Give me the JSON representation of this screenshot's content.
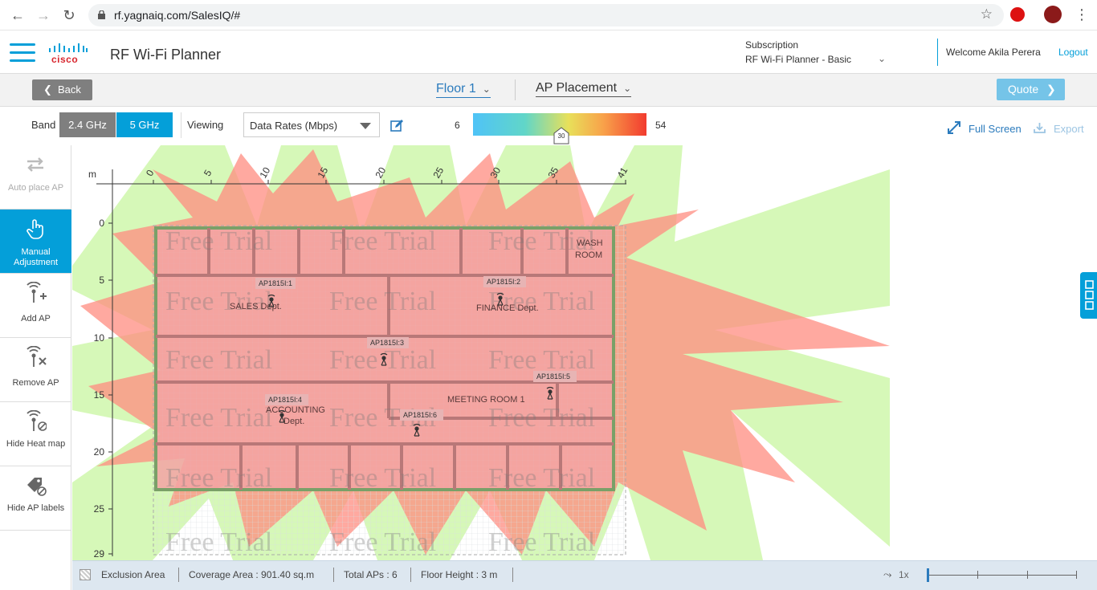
{
  "browser": {
    "url": "rf.yagnaiq.com/SalesIQ/#"
  },
  "header": {
    "brand": "cisco",
    "app_title": "RF Wi-Fi Planner",
    "subscription_label": "Subscription",
    "subscription_value": "RF Wi-Fi Planner - Basic",
    "welcome": "Welcome Akila Perera",
    "logout": "Logout"
  },
  "subheader": {
    "back": "Back",
    "floor": "Floor 1",
    "mode": "AP Placement",
    "quote": "Quote"
  },
  "toolbar": {
    "band_label": "Band",
    "band_24": "2.4 GHz",
    "band_5": "5 GHz",
    "band_selected": "5 GHz",
    "viewing_label": "Viewing",
    "viewing_value": "Data Rates (Mbps)",
    "scale_min": "6",
    "scale_max": "54",
    "scale_value": "30",
    "fullscreen": "Full Screen",
    "export": "Export"
  },
  "tools": [
    {
      "label": "Auto place AP",
      "icon": "auto-place-icon",
      "state": "disabled"
    },
    {
      "label": "Manual Adjustment",
      "icon": "hand-pointer-icon",
      "state": "active"
    },
    {
      "label": "Add AP",
      "icon": "add-ap-icon",
      "state": "normal"
    },
    {
      "label": "Remove AP",
      "icon": "remove-ap-icon",
      "state": "normal"
    },
    {
      "label": "Hide Heat map",
      "icon": "hide-heatmap-icon",
      "state": "normal"
    },
    {
      "label": "Hide AP labels",
      "icon": "hide-labels-icon",
      "state": "normal"
    }
  ],
  "map": {
    "unit": "m",
    "x_ticks": [
      "0",
      "5",
      "10",
      "15",
      "20",
      "25",
      "30",
      "35",
      "41"
    ],
    "y_ticks": [
      "0",
      "5",
      "10",
      "15",
      "20",
      "25",
      "29"
    ],
    "rooms": {
      "sales": "SALES Dept.",
      "finance": "FINANCE Dept.",
      "accounting_1": "ACCOUNTING",
      "accounting_2": "Dept.",
      "meeting": "MEETING ROOM 1",
      "wash_1": "WASH",
      "wash_2": "ROOM"
    },
    "watermark": "Free Trial",
    "aps": [
      {
        "name": "AP1815I:1"
      },
      {
        "name": "AP1815I:2"
      },
      {
        "name": "AP1815I:3"
      },
      {
        "name": "AP1815I:4"
      },
      {
        "name": "AP1815I:5"
      },
      {
        "name": "AP1815I:6"
      }
    ]
  },
  "footer": {
    "exclusion": "Exclusion Area",
    "coverage": "Coverage Area : 901.40  sq.m",
    "total_aps": "Total APs : 6",
    "floor_height": "Floor Height : 3 m",
    "zoom": "1x"
  }
}
